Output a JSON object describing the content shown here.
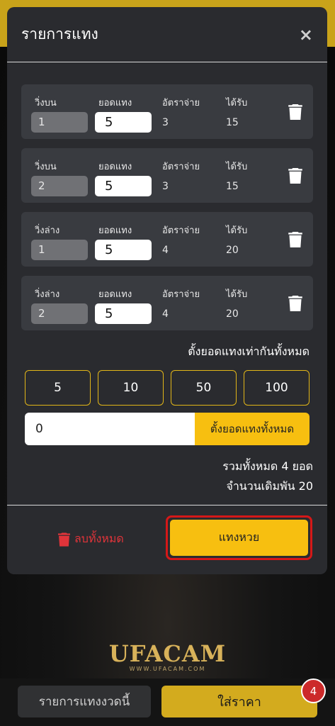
{
  "modal": {
    "title": "รายการแทง",
    "close_symbol": "×",
    "columns": {
      "type": "",
      "amount": "ยอดแทง",
      "rate": "อัตราจ่าย",
      "receive": "ได้รับ"
    },
    "bets": [
      {
        "type": "วิ่งบน",
        "number": "1",
        "amount": "5",
        "rate": "3",
        "receive": "15"
      },
      {
        "type": "วิ่งบน",
        "number": "2",
        "amount": "5",
        "rate": "3",
        "receive": "15"
      },
      {
        "type": "วิ่งล่าง",
        "number": "1",
        "amount": "5",
        "rate": "4",
        "receive": "20"
      },
      {
        "type": "วิ่งล่าง",
        "number": "2",
        "amount": "5",
        "rate": "4",
        "receive": "20"
      }
    ],
    "set_all_label": "ตั้งยอดแทงเท่ากันทั้งหมด",
    "quick_amounts": [
      "5",
      "10",
      "50",
      "100"
    ],
    "set_all_input_value": "0",
    "set_all_button": "ตั้งยอดแทงทั้งหมด",
    "summary_total": "รวมทั้งหมด 4 ยอด",
    "summary_amount": "จำนวนเดิมพัน 20",
    "delete_all_label": "ลบทั้งหมด",
    "submit_label": "แทงหวย"
  },
  "logo": {
    "main": "UFACAM",
    "sub": "WWW.UFACAM.COM"
  },
  "bottom_bar": {
    "list_button": "รายการแทงงวดนี้",
    "price_button": "ใส่ราคา",
    "badge_count": "4"
  },
  "colors": {
    "accent_yellow": "#f7bf10",
    "danger_red": "#e0343a",
    "modal_bg": "#2a2b2f",
    "card_bg": "#393b40"
  }
}
